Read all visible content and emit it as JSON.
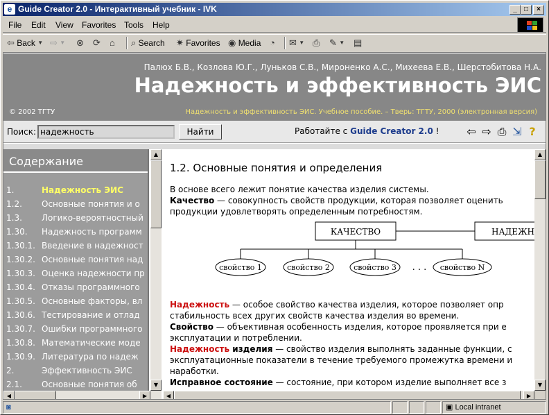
{
  "window": {
    "title": "Guide Creator 2.0 - Интерактивный учебник - IVK",
    "controls": {
      "minimize": "_",
      "maximize": "□",
      "close": "×"
    }
  },
  "menu": [
    "File",
    "Edit",
    "View",
    "Favorites",
    "Tools",
    "Help"
  ],
  "toolbar": {
    "back": "Back",
    "search": "Search",
    "favorites": "Favorites",
    "media": "Media"
  },
  "banner": {
    "authors": "Палюх Б.В., Козлова Ю.Г., Луньков С.В., Мироненко А.С., Михеева Е.В., Шерстобитова Н.А.",
    "title": "Надежность и эффективность ЭИС",
    "copyright": "© 2002 ТГТУ",
    "citation": "Надежность и эффективность ЭИС. Учебное пособие. – Тверь: ТГТУ, 2000 (электронная версия)"
  },
  "search": {
    "label": "Поиск:",
    "value": "надежность",
    "button": "Найти"
  },
  "promo": {
    "prefix": "Работайте с",
    "product": "Guide Creator 2.0",
    "suffix": "!"
  },
  "nav_icons": [
    "back-arrow-icon",
    "forward-arrow-icon",
    "print-icon",
    "export-icon",
    "help-icon"
  ],
  "toc": {
    "heading": "Содержание",
    "items": [
      {
        "num": "1.",
        "label": "Надежность ЭИС",
        "active": true
      },
      {
        "num": "1.2.",
        "label": "Основные понятия и о"
      },
      {
        "num": "1.3.",
        "label": "Логико-вероятностный"
      },
      {
        "num": "1.30.",
        "label": "Надежность программ"
      },
      {
        "num": "1.30.1.",
        "label": "Введение в надежност"
      },
      {
        "num": "1.30.2.",
        "label": "Основные понятия над"
      },
      {
        "num": "1.30.3.",
        "label": "Оценка надежности пр"
      },
      {
        "num": "1.30.4.",
        "label": "Отказы программного"
      },
      {
        "num": "1.30.5.",
        "label": "Основные факторы, вл"
      },
      {
        "num": "1.30.6.",
        "label": "Тестирование и отлад"
      },
      {
        "num": "1.30.7.",
        "label": "Ошибки программного"
      },
      {
        "num": "1.30.8.",
        "label": "Математические моде"
      },
      {
        "num": "1.30.9.",
        "label": "Литература по надеж"
      },
      {
        "num": "2.",
        "label": "Эффективность ЭИС"
      },
      {
        "num": "2.1.",
        "label": "Основные понятия об"
      }
    ]
  },
  "content": {
    "section_title": "1.2. Основные понятия и определения",
    "intro": "В основе всего лежит понятие качества изделия системы.",
    "p1_term": "Качество",
    "p1_text": " — совокупность свойств продукции, которая позволяет оценить",
    "p1_cont": "продукции удовлетворять определенным потребностям.",
    "diagram": {
      "top_left": "КАЧЕСТВО",
      "top_right": "НАДЕЖНОСТЬ",
      "props": [
        "свойство 1",
        "свойство 2",
        "свойство 3",
        "свойство N"
      ],
      "ellipsis": ". . ."
    },
    "d1_term": "Надежность",
    "d1_text": " — особое свойство качества изделия, которое позволяет опр",
    "d1_cont": "стабильность всех других свойств качества изделия во времени.",
    "d2_term": "Свойство",
    "d2_text": " — объективная особенность изделия, которое проявляется при е",
    "d2_cont": "эксплуатации и потреблении.",
    "d3_term": "Надежность",
    "d3_term2": " изделия",
    "d3_text": " — свойство изделия выполнять заданные функции, с",
    "d3_cont": "эксплуатационные показатели в течение требуемого промежутка времени и",
    "d3_cont2": "наработки.",
    "d4_term": "Исправное состояние",
    "d4_text": " — состояние, при котором изделие выполняет все з"
  },
  "status": {
    "zone": "Local intranet"
  }
}
